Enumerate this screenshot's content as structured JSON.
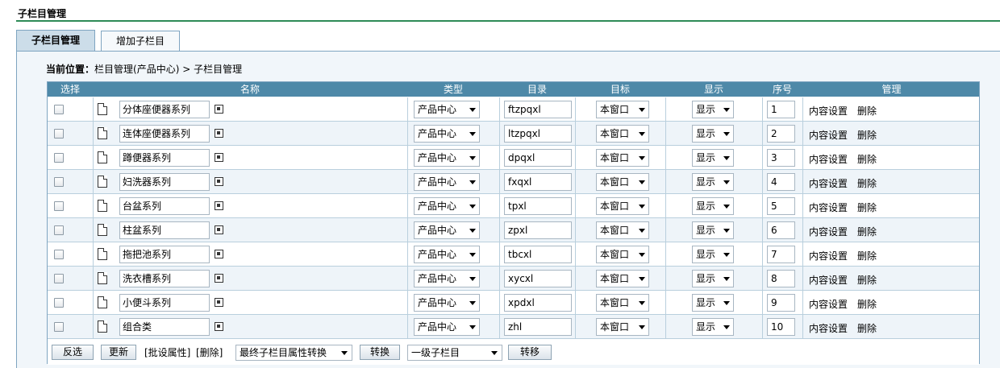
{
  "page_title": "子栏目管理",
  "tabs": [
    {
      "label": "子栏目管理",
      "active": true
    },
    {
      "label": "增加子栏目",
      "active": false
    }
  ],
  "breadcrumb": {
    "label": "当前位置：",
    "path": "栏目管理(产品中心) > 子栏目管理"
  },
  "table": {
    "headers": [
      "选择",
      "名称",
      "类型",
      "目录",
      "目标",
      "显示",
      "序号",
      "管理"
    ],
    "rows": [
      {
        "name": "分体座便器系列",
        "type": "产品中心",
        "dir": "ftzpqxl",
        "target": "本窗口",
        "display": "显示",
        "order": "1",
        "content": "内容设置",
        "delete": "删除"
      },
      {
        "name": "连体座便器系列",
        "type": "产品中心",
        "dir": "ltzpqxl",
        "target": "本窗口",
        "display": "显示",
        "order": "2",
        "content": "内容设置",
        "delete": "删除"
      },
      {
        "name": "蹲便器系列",
        "type": "产品中心",
        "dir": "dpqxl",
        "target": "本窗口",
        "display": "显示",
        "order": "3",
        "content": "内容设置",
        "delete": "删除"
      },
      {
        "name": "妇洗器系列",
        "type": "产品中心",
        "dir": "fxqxl",
        "target": "本窗口",
        "display": "显示",
        "order": "4",
        "content": "内容设置",
        "delete": "删除"
      },
      {
        "name": "台盆系列",
        "type": "产品中心",
        "dir": "tpxl",
        "target": "本窗口",
        "display": "显示",
        "order": "5",
        "content": "内容设置",
        "delete": "删除"
      },
      {
        "name": "柱盆系列",
        "type": "产品中心",
        "dir": "zpxl",
        "target": "本窗口",
        "display": "显示",
        "order": "6",
        "content": "内容设置",
        "delete": "删除"
      },
      {
        "name": "拖把池系列",
        "type": "产品中心",
        "dir": "tbcxl",
        "target": "本窗口",
        "display": "显示",
        "order": "7",
        "content": "内容设置",
        "delete": "删除"
      },
      {
        "name": "洗衣槽系列",
        "type": "产品中心",
        "dir": "xycxl",
        "target": "本窗口",
        "display": "显示",
        "order": "8",
        "content": "内容设置",
        "delete": "删除"
      },
      {
        "name": "小便斗系列",
        "type": "产品中心",
        "dir": "xpdxl",
        "target": "本窗口",
        "display": "显示",
        "order": "9",
        "content": "内容设置",
        "delete": "删除"
      },
      {
        "name": "组合类",
        "type": "产品中心",
        "dir": "zhl",
        "target": "本窗口",
        "display": "显示",
        "order": "10",
        "content": "内容设置",
        "delete": "删除"
      }
    ]
  },
  "footer": {
    "invert_label": "反选",
    "update_label": "更新",
    "batch_label": "[批设属性]",
    "delete_label": "[删除]",
    "convert_select": "最终子栏目属性转换",
    "convert_button": "转换",
    "level_select": "一级子栏目",
    "move_button": "转移"
  },
  "colors": {
    "header_bg": "#4e89a8",
    "accent_rule": "#2e8b57",
    "panel_bg": "#f1f6fa",
    "active_tab_bg": "#ccdde9"
  }
}
